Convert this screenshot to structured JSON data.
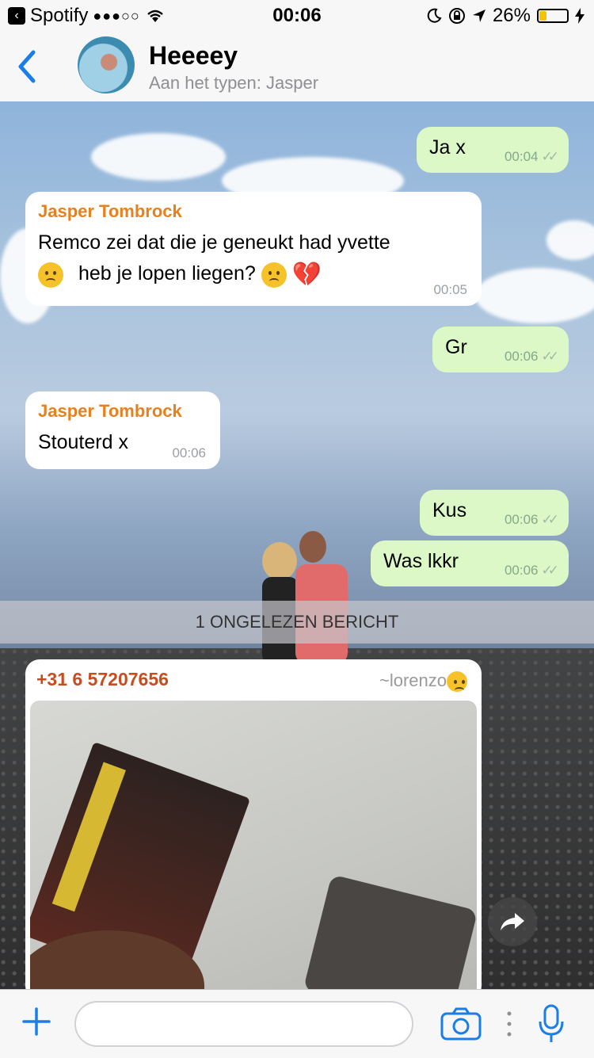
{
  "status_bar": {
    "carrier": "Spotify",
    "signal": "●●●○○",
    "time": "00:06",
    "battery": "26%",
    "battery_level": 0.26
  },
  "header": {
    "title": "Heeeey",
    "subtitle": "Aan het typen: Jasper"
  },
  "messages": [
    {
      "text": "Ja x",
      "time": "00:04"
    },
    {
      "sender": "Jasper Tombrock",
      "line1": "Remco zei dat die je geneukt had yvette",
      "line2": "heb je lopen liegen?",
      "time": "00:05"
    },
    {
      "text": "Gr",
      "time": "00:06"
    },
    {
      "sender": "Jasper Tombrock",
      "text": "Stouterd x",
      "time": "00:06"
    },
    {
      "text": "Kus",
      "time": "00:06"
    },
    {
      "text": "Was lkkr",
      "time": "00:06"
    }
  ],
  "unread_banner": "1 ONGELEZEN BERICHT",
  "media_message": {
    "phone": "+31 6 57207656",
    "alias": "~lorenzo"
  },
  "colors": {
    "accent": "#1a7ee8",
    "sender_name": "#e6811e",
    "outgoing_bubble": "#dcf8c6"
  }
}
